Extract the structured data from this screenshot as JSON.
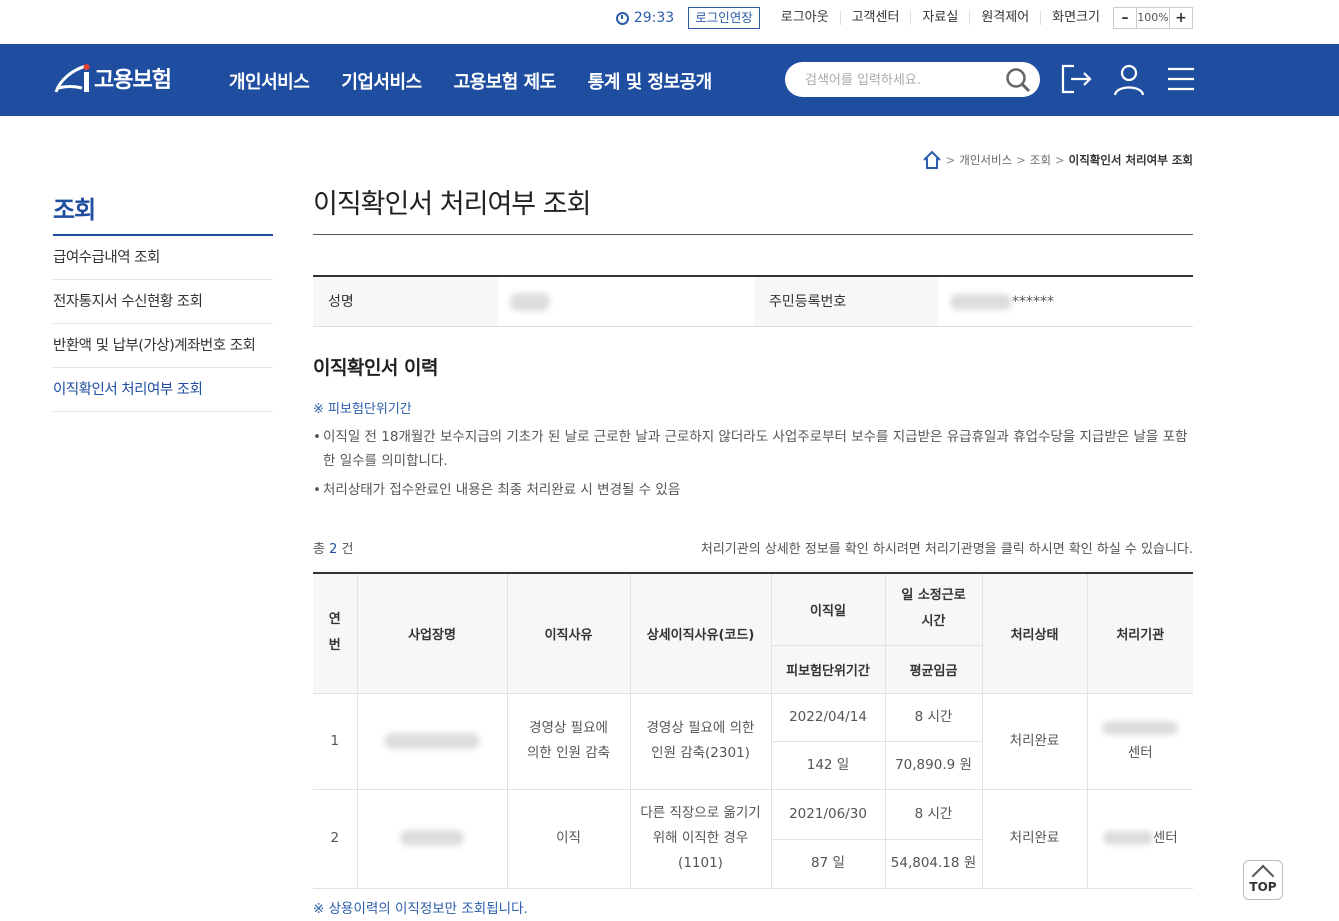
{
  "util": {
    "timer": "29:33",
    "extend_label": "로그인연장",
    "links": [
      "로그아웃",
      "고객센터",
      "자료실",
      "원격제어",
      "화면크기"
    ],
    "zoom_minus": "–",
    "zoom_value": "100%",
    "zoom_plus": "+"
  },
  "nav": {
    "logo_text": "고용보험",
    "menu": [
      "개인서비스",
      "기업서비스",
      "고용보험 제도",
      "통계 및 정보공개"
    ],
    "search_placeholder": "검색어를 입력하세요.",
    "colors": {
      "nav_bg": "#1f4ea1",
      "accent": "#2b5dab"
    }
  },
  "breadcrumb": [
    "개인서비스",
    "조회",
    "이직확인서 처리여부 조회"
  ],
  "sidebar": {
    "title": "조회",
    "items": [
      "급여수급내역 조회",
      "전자통지서 수신현황 조회",
      "반환액 및 납부(가상)계좌번호 조회",
      "이직확인서 처리여부 조회"
    ],
    "active_index": 3
  },
  "main": {
    "title": "이직확인서 처리여부 조회",
    "info": {
      "name_label": "성명",
      "rrn_label": "주민등록번호",
      "rrn_masked": "******"
    },
    "history_title": "이직확인서 이력",
    "note_title": "※ 피보험단위기간",
    "bullets": [
      "이직일 전 18개월간 보수지급의 기초가 된 날로 근로한 날과 근로하지 않더라도 사업주로부터 보수를 지급받은 유급휴일과 휴업수당을 지급받은 날을 포함한 일수를 의미합니다.",
      "처리상태가 접수완료인 내용은 최종 처리완료 시 변경될 수 있음"
    ],
    "count_prefix": "총",
    "count": "2",
    "count_suffix": "건",
    "hint": "처리기관의 상세한 정보를 확인 하시려면 처리기관명을 클릭 하시면 확인 하실 수 있습니다.",
    "table": {
      "headers": {
        "no": "연번",
        "company": "사업장명",
        "reason": "이직사유",
        "detail": "상세이직사유(코드)",
        "date": "이직일",
        "hours": "일 소정근로시간",
        "period": "피보험단위기간",
        "wage": "평균임금",
        "status": "처리상태",
        "agency": "처리기관"
      },
      "rows": [
        {
          "no": "1",
          "reason": "경영상 필요에 의한 인원 감축",
          "detail": "경영상 필요에 의한 인원 감축(2301)",
          "date": "2022/04/14",
          "hours": "8 시간",
          "period": "142 일",
          "wage": "70,890.9 원",
          "status": "처리완료",
          "agency_suffix": "센터"
        },
        {
          "no": "2",
          "reason": "이직",
          "detail": "다른 직장으로 옮기기 위해 이직한 경우(1101)",
          "date": "2021/06/30",
          "hours": "8 시간",
          "period": "87 일",
          "wage": "54,804.18 원",
          "status": "처리완료",
          "agency_suffix": "센터"
        }
      ]
    },
    "foot_note": "※ 상용이력의 이직정보만 조회됩니다."
  },
  "top_button": "TOP"
}
